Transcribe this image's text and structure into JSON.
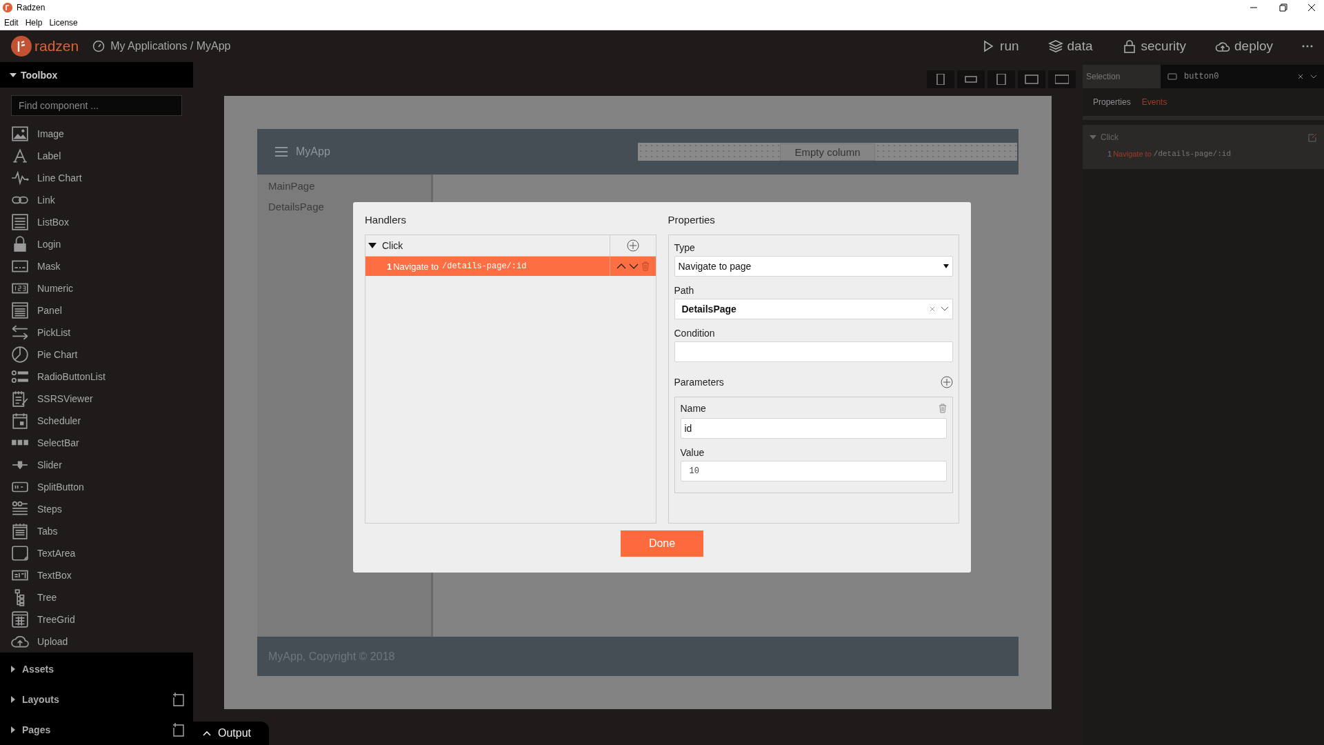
{
  "window": {
    "title": "Radzen"
  },
  "menu": [
    "Edit",
    "Help",
    "License"
  ],
  "topbar": {
    "logo": "radzen",
    "breadcrumb": "My Applications / MyApp",
    "actions": [
      {
        "label": "run"
      },
      {
        "label": "data"
      },
      {
        "label": "security"
      },
      {
        "label": "deploy"
      }
    ]
  },
  "toolbox": {
    "title": "Toolbox",
    "expanded": true,
    "placeholder": "Find component ...",
    "items": [
      "Image",
      "Label",
      "Line Chart",
      "Link",
      "ListBox",
      "Login",
      "Mask",
      "Numeric",
      "Panel",
      "PickList",
      "Pie Chart",
      "RadioButtonList",
      "SSRSViewer",
      "Scheduler",
      "SelectBar",
      "Slider",
      "SplitButton",
      "Steps",
      "Tabs",
      "TextArea",
      "TextBox",
      "Tree",
      "TreeGrid",
      "Upload"
    ]
  },
  "sections": [
    {
      "label": "Assets",
      "expanded": false,
      "addable": false
    },
    {
      "label": "Layouts",
      "expanded": false,
      "addable": true
    },
    {
      "label": "Pages",
      "expanded": false,
      "addable": true
    }
  ],
  "canvas": {
    "app_title": "MyApp",
    "empty_column": "Empty column",
    "nav": [
      "MainPage",
      "DetailsPage"
    ],
    "footer": "MyApp, Copyright © 2018"
  },
  "selection": {
    "label": "Selection",
    "value": "button0"
  },
  "inspector_tabs": [
    {
      "label": "Properties",
      "selected": false
    },
    {
      "label": "Events",
      "selected": true
    }
  ],
  "events": [
    {
      "name": "Click",
      "expanded": true,
      "handlers": [
        {
          "index": "1",
          "action": "Navigate to",
          "path": "/details-page/:id"
        }
      ]
    }
  ],
  "dialog": {
    "handlers_title": "Handlers",
    "properties_title": "Properties",
    "event": {
      "name": "Click",
      "expanded": true
    },
    "handlers": [
      {
        "index": "1",
        "action": "Navigate to",
        "path": "/details-page/:id",
        "selected": true
      }
    ],
    "type_label": "Type",
    "type_value": "Navigate to page",
    "path_label": "Path",
    "path_value": "DetailsPage",
    "condition_label": "Condition",
    "parameters_label": "Parameters",
    "parameters": [
      {
        "name_label": "Name",
        "name_value": "id",
        "value_label": "Value",
        "value_value": "10"
      }
    ],
    "done": "Done"
  },
  "output": {
    "label": "Output"
  }
}
